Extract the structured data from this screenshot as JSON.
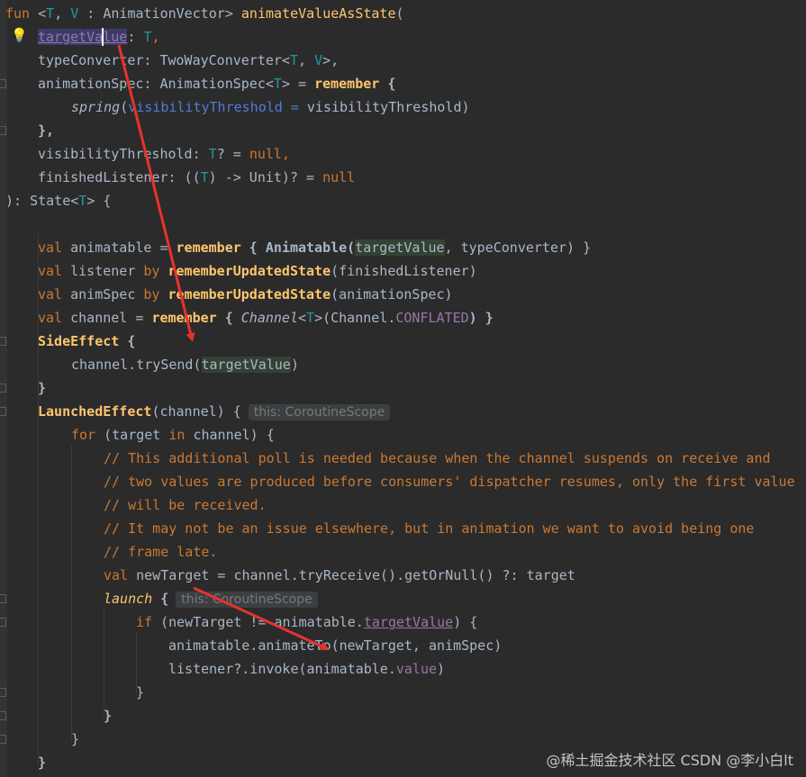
{
  "editor": {
    "code": {
      "l1": {
        "t0": "fun ",
        "t1": "<",
        "t2": "T",
        "t3": ", ",
        "t4": "V",
        "t5": " : AnimationVector> ",
        "t6": "animateValueAsState",
        "t7": "("
      },
      "l2": {
        "t0": "targetValue",
        "t1": ": ",
        "t2": "T",
        "t3": ","
      },
      "l3": {
        "t0": "typeConverter: TwoWayConverter<",
        "t1": "T",
        "t2": ", ",
        "t3": "V",
        "t4": ">,"
      },
      "l4": {
        "t0": "animationSpec: AnimationSpec<",
        "t1": "T",
        "t2": "> = ",
        "t3": "remember",
        "t4": " {"
      },
      "l5": {
        "t0": "spring",
        "t1": "(",
        "t2": "visibilityThreshold = ",
        "t3": "visibilityThreshold)"
      },
      "l6": {
        "t0": "},"
      },
      "l7": {
        "t0": "visibilityThreshold: ",
        "t1": "T",
        "t2": "? = ",
        "t3": "null",
        "t4": ","
      },
      "l8": {
        "t0": "finishedListener: ((",
        "t1": "T",
        "t2": ") -> Unit)? = ",
        "t3": "null"
      },
      "l9": {
        "t0": "): State<",
        "t1": "T",
        "t2": "> {"
      },
      "l10": {
        "t0": "val",
        "t1": " animatable = ",
        "t2": "remember",
        "t3": " { Animatable(",
        "t4": "targetValue",
        "t5": ", typeConverter) }"
      },
      "l11": {
        "t0": "val",
        "t1": " listener ",
        "t2": "by",
        "t3": " ",
        "t4": "rememberUpdatedState",
        "t5": "(finishedListener)"
      },
      "l12": {
        "t0": "val",
        "t1": " animSpec ",
        "t2": "by",
        "t3": " ",
        "t4": "rememberUpdatedState",
        "t5": "(animationSpec)"
      },
      "l13": {
        "t0": "val",
        "t1": " channel = ",
        "t2": "remember",
        "t3": " { ",
        "t4": "Channel",
        "t5": "<",
        "t6": "T",
        "t7": ">(Channel.",
        "t8": "CONFLATED",
        "t9": ") }"
      },
      "l14": {
        "t0": "SideEffect",
        "t1": " {"
      },
      "l15": {
        "t0": "channel.trySend(",
        "t1": "targetValue",
        "t2": ")"
      },
      "l16": {
        "t0": "}"
      },
      "l17": {
        "t0": "LaunchedEffect",
        "t1": "(channel) {",
        "hint": "this: CoroutineScope"
      },
      "l18": {
        "t0": "for",
        "t1": " (target ",
        "t2": "in",
        "t3": " channel) {"
      },
      "l19": {
        "t0": "// This additional poll is needed because when the channel suspends on receive and"
      },
      "l20": {
        "t0": "// two values are produced before consumers' dispatcher resumes, only the first value"
      },
      "l21": {
        "t0": "// will be received."
      },
      "l22": {
        "t0": "// It may not be an issue elsewhere, but in animation we want to avoid being one"
      },
      "l23": {
        "t0": "// frame late."
      },
      "l24": {
        "t0": "val",
        "t1": " newTarget = channel.tryReceive().getOrNull() ?: target"
      },
      "l25": {
        "t0": "launch",
        "t1": " {",
        "hint": "this: CoroutineScope"
      },
      "l26": {
        "t0": "if",
        "t1": " (newTarget != animatable.",
        "t2": "targetValue",
        "t3": ") {"
      },
      "l27": {
        "t0": "animatable.animateTo(newTarget, animSpec)"
      },
      "l28": {
        "t0": "listener?.invoke(animatable.",
        "t1": "value",
        "t2": ")"
      },
      "l29": {
        "t0": "}"
      },
      "l30": {
        "t0": "}"
      },
      "l31": {
        "t0": "}"
      },
      "l32": {
        "t0": "}"
      }
    },
    "watermark": "@稀土掘金技术社区 CSDN @李小白lt",
    "colors": {
      "background": "#2b2b2b",
      "keyword": "#cc7832",
      "function": "#ffc66d",
      "type_param": "#20999d",
      "annotation_arrow": "#e8322d"
    }
  }
}
